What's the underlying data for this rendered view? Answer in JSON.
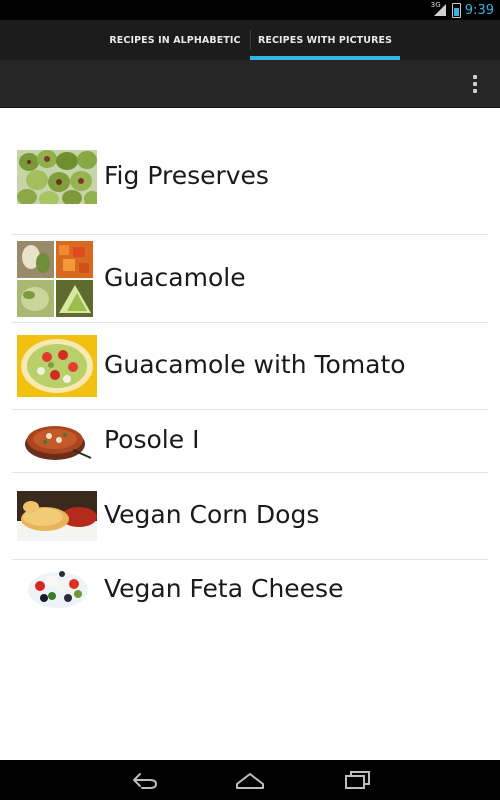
{
  "status_bar": {
    "network": "3G",
    "time": "9:39",
    "signal_icon": "signal-icon",
    "battery_icon": "battery-charging-icon"
  },
  "tabs": [
    {
      "label": "RECIPES IN ALPHABETIC",
      "selected": false
    },
    {
      "label": "RECIPES WITH PICTURES",
      "selected": true
    }
  ],
  "action_bar": {
    "overflow_icon": "overflow-menu-icon"
  },
  "recipes": [
    {
      "name": "Fig Preserves",
      "thumbnail": "fig-preserves-photo"
    },
    {
      "name": "Guacamole",
      "thumbnail": "guacamole-collage-photo"
    },
    {
      "name": "Guacamole with Tomato",
      "thumbnail": "guacamole-tomato-photo"
    },
    {
      "name": "Posole I",
      "thumbnail": "posole-bowl-photo"
    },
    {
      "name": "Vegan Corn Dogs",
      "thumbnail": "vegan-corn-dogs-photo"
    },
    {
      "name": "Vegan Feta Cheese",
      "thumbnail": "vegan-feta-salad-photo"
    }
  ],
  "nav_bar": {
    "back_icon": "back-icon",
    "home_icon": "home-icon",
    "recents_icon": "recent-apps-icon"
  },
  "colors": {
    "accent": "#33b5e5",
    "tab_bar": "#1c1c1c",
    "action_bar": "#262626",
    "status_bar": "#000000",
    "list_background": "#ffffff",
    "divider": "#e4e4e4"
  }
}
